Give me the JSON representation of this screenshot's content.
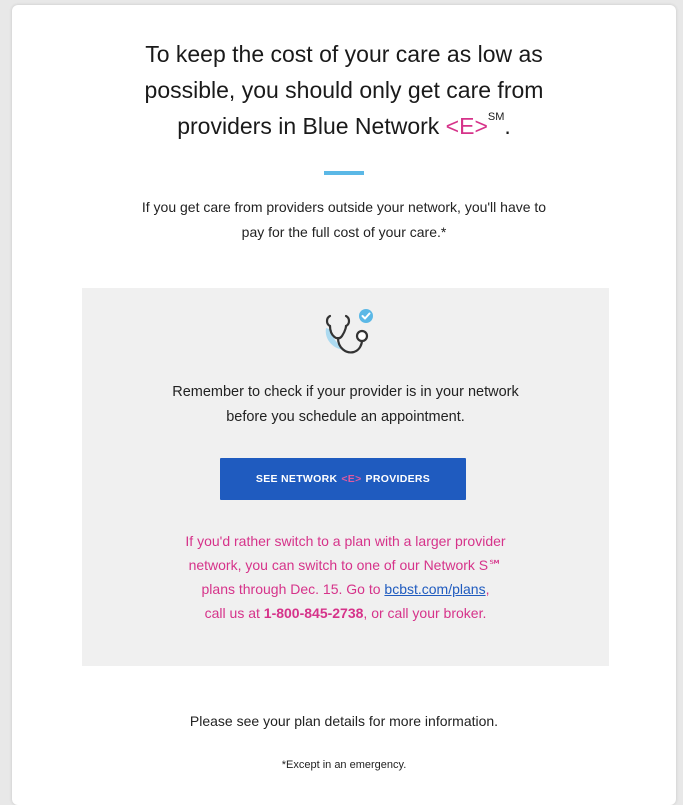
{
  "headline": {
    "line1": "To keep the cost of your care as low as",
    "line2": "possible, you should only get care from",
    "line3_prefix": "providers in Blue Network ",
    "network_brand": "<E>",
    "service_mark": "SM",
    "line3_suffix": "."
  },
  "intro": {
    "line1": "If you get care from providers outside your network, you'll have to",
    "line2": "pay for the full cost of your care.*"
  },
  "callout": {
    "icon": "stethoscope-check-icon",
    "reminder_line1": "Remember to check if your provider is in your network",
    "reminder_line2": "before you schedule an appointment.",
    "button": {
      "prefix": "SEE NETWORK",
      "brand": "<E>",
      "suffix": "PROVIDERS"
    },
    "switch": {
      "line1": "If you'd rather switch to a plan with a larger provider",
      "line2": "network, you can switch to one of our Network S℠",
      "line3_prefix": "plans through Dec. 15. Go to ",
      "link": "bcbst.com/plans",
      "line3_suffix": ",",
      "line4_prefix": "call us at ",
      "phone": "1-800-845-2738",
      "line4_suffix": ", or call your broker."
    }
  },
  "footer": {
    "details": "Please see your plan details for more information.",
    "footnote": "*Except in an emergency."
  },
  "colors": {
    "brand_pink": "#d6338a",
    "button_blue": "#1f5bbf",
    "accent_blue": "#5bb8e6",
    "panel_gray": "#f0f0f0"
  }
}
